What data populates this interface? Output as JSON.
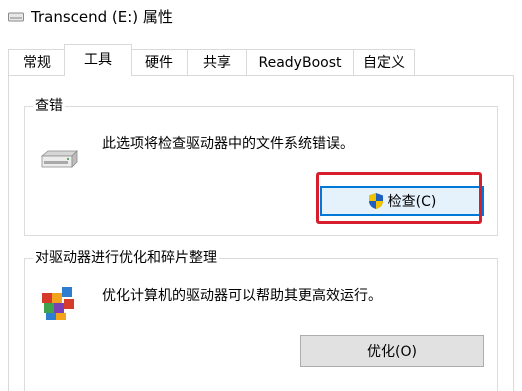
{
  "window": {
    "title": "Transcend (E:) 属性"
  },
  "tabs": [
    {
      "label": "常规"
    },
    {
      "label": "工具"
    },
    {
      "label": "硬件"
    },
    {
      "label": "共享"
    },
    {
      "label": "ReadyBoost"
    },
    {
      "label": "自定义"
    }
  ],
  "active_tab": "工具",
  "error_check": {
    "title": "查错",
    "description": "此选项将检查驱动器中的文件系统错误。",
    "button_label": "检查(C)",
    "icon": "drive-icon",
    "button_icon": "shield-icon"
  },
  "optimize": {
    "title": "对驱动器进行优化和碎片整理",
    "description": "优化计算机的驱动器可以帮助其更高效运行。",
    "button_label": "优化(O)",
    "icon": "defrag-icon"
  },
  "colors": {
    "highlight": "#d81e2c",
    "focus": "#0078d7"
  }
}
